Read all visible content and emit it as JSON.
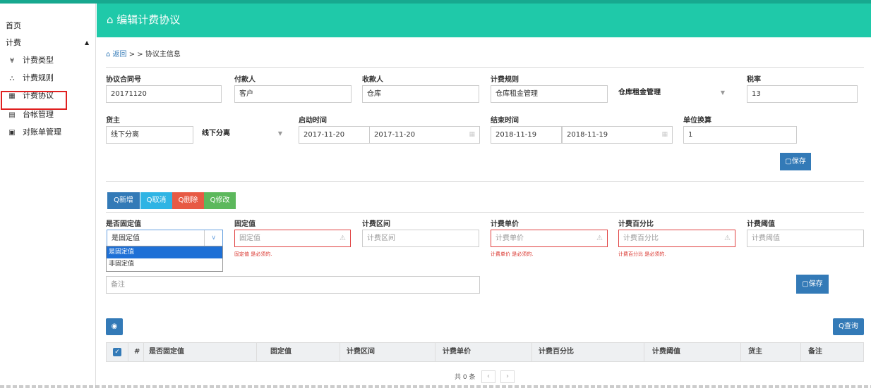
{
  "sidebar": {
    "home": "首页",
    "billing": "计费",
    "items": [
      {
        "label": "计费类型",
        "icon": "¥"
      },
      {
        "label": "计费规则",
        "icon": "⛬"
      },
      {
        "label": "计费协议",
        "icon": "▦"
      },
      {
        "label": "台帐管理",
        "icon": "▤"
      },
      {
        "label": "对账单管理",
        "icon": "▣"
      }
    ]
  },
  "header": {
    "title": "编辑计费协议"
  },
  "breadcrumb": {
    "back": "返回",
    "sep": " > > ",
    "current": "协议主信息"
  },
  "form": {
    "contract_no": {
      "label": "协议合同号",
      "value": "20171120"
    },
    "payer": {
      "label": "付款人",
      "value": "客户"
    },
    "payee": {
      "label": "收款人",
      "value": "仓库"
    },
    "billing_rule": {
      "label": "计费规则",
      "value": "仓库租金管理",
      "select": "仓库租金管理"
    },
    "tax_rate": {
      "label": "税率",
      "value": "13"
    },
    "owner": {
      "label": "货主",
      "value": "线下分离",
      "select": "线下分离"
    },
    "start_time": {
      "label": "启动时间",
      "value1": "2017-11-20",
      "value2": "2017-11-20"
    },
    "end_time": {
      "label": "结束时间",
      "value1": "2018-11-19",
      "value2": "2018-11-19"
    },
    "unit_conv": {
      "label": "单位换算",
      "value": "1"
    },
    "save_label": "保存"
  },
  "toolbar": {
    "add": "新增",
    "cancel": "取消",
    "delete": "删除",
    "modify": "修改"
  },
  "detail": {
    "is_fixed": {
      "label": "是否固定值",
      "value": "是固定值",
      "options": [
        "是固定值",
        "非固定值"
      ]
    },
    "fixed_value": {
      "label": "固定值",
      "placeholder": "固定值",
      "error": "固定值 是必须的."
    },
    "billing_range": {
      "label": "计费区间",
      "placeholder": "计费区间"
    },
    "unit_price": {
      "label": "计费单价",
      "placeholder": "计费单价",
      "error": "计费单价 是必须的."
    },
    "percent": {
      "label": "计费百分比",
      "placeholder": "计费百分比",
      "error": "计费百分比 是必须的."
    },
    "threshold": {
      "label": "计费阈值",
      "placeholder": "计费阈值"
    },
    "remark_placeholder": "备注",
    "save_label": "保存"
  },
  "table": {
    "query": "查询",
    "columns": [
      "#",
      "是否固定值",
      "固定值",
      "计费区间",
      "计费单价",
      "计费百分比",
      "计费阈值",
      "货主",
      "备注"
    ],
    "total": "共 0 条"
  },
  "colors": {
    "header": "#1fc9a9",
    "primary": "#337ab7",
    "danger": "#e75a44"
  }
}
